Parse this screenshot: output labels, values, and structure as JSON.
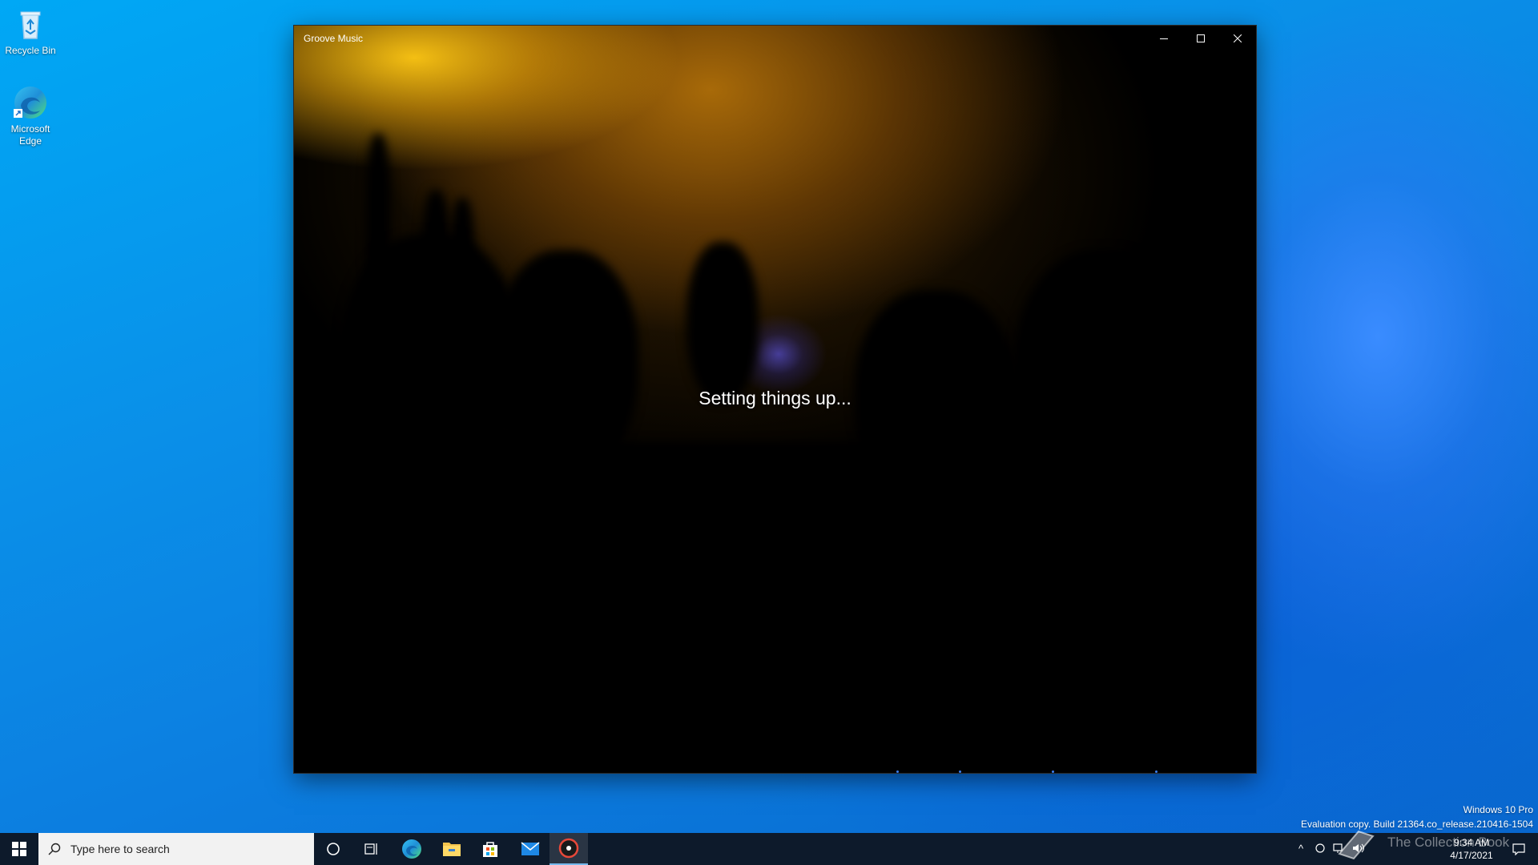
{
  "desktop": {
    "icons": [
      {
        "label": "Recycle Bin",
        "icon": "recycle-bin-icon"
      },
      {
        "label": "Microsoft Edge",
        "icon": "edge-icon"
      }
    ]
  },
  "window": {
    "title": "Groove Music",
    "controls": {
      "minimize": "minimize-icon",
      "maximize": "maximize-icon",
      "close": "close-icon"
    },
    "status_text": "Setting things up..."
  },
  "watermark": {
    "edition": "Windows 10 Pro",
    "build": "Evaluation copy. Build 21364.co_release.210416-1504"
  },
  "taskbar": {
    "search_placeholder": "Type here to search",
    "apps": [
      {
        "name": "Cortana",
        "icon": "cortana-circle-icon"
      },
      {
        "name": "Task View",
        "icon": "task-view-icon"
      },
      {
        "name": "Microsoft Edge",
        "icon": "edge-icon"
      },
      {
        "name": "File Explorer",
        "icon": "folder-icon"
      },
      {
        "name": "Microsoft Store",
        "icon": "store-icon"
      },
      {
        "name": "Mail",
        "icon": "mail-icon"
      },
      {
        "name": "Groove Music",
        "icon": "groove-music-icon",
        "active": true
      }
    ],
    "clock": {
      "time": "9:34 AM",
      "date": "4/17/2021"
    },
    "overlay_logo_text": "The Collection Book"
  },
  "colors": {
    "desktop_blue": "#0a8fe8",
    "taskbar": "#0d1a2b",
    "accent": "#76b9ed"
  }
}
